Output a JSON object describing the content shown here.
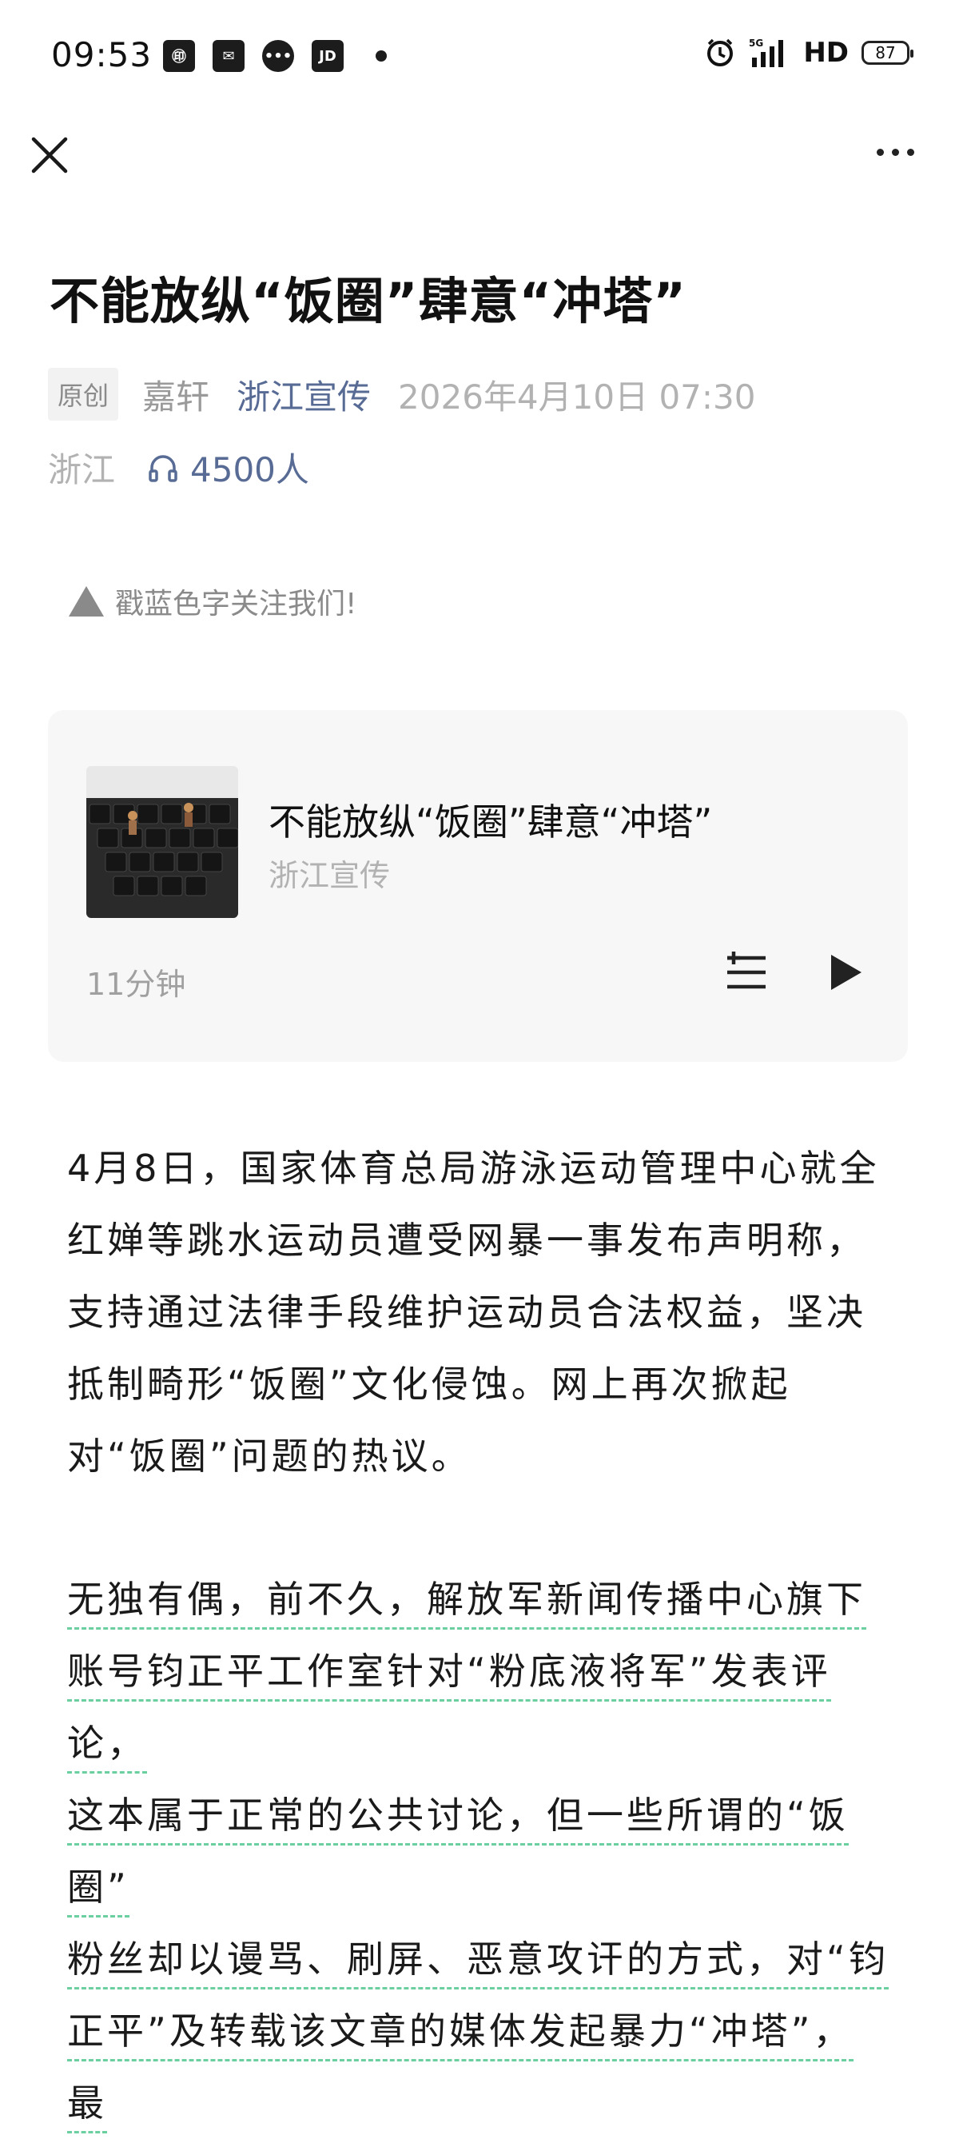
{
  "status_bar": {
    "time": "09:53",
    "left_icons": [
      {
        "name": "app-icon-1",
        "text": "㊞"
      },
      {
        "name": "app-icon-2",
        "text": "✉"
      },
      {
        "name": "message-icon",
        "text": "•••"
      },
      {
        "name": "jd-icon",
        "text": "JD"
      }
    ],
    "network": "5G",
    "hd": "HD",
    "battery": "87"
  },
  "article": {
    "title": "不能放纵“饭圈”肆意“冲塔”",
    "badge": "原创",
    "author": "嘉轩",
    "account": "浙江宣传",
    "date": "2026年4月10日 07:30",
    "location": "浙江",
    "listeners": "4500人",
    "follow_tip": "戳蓝色字关注我们!"
  },
  "audio_card": {
    "title": "不能放纵“饭圈”肆意“冲塔”",
    "source": "浙江宣传",
    "duration": "11分钟"
  },
  "body": {
    "paragraph1": "4月8日，国家体育总局游泳运动管理中心就全红婵等跳水运动员遭受网暴一事发布声明称，支持通过法律手段维护运动员合法权益，坚决抵制畸形“饭圈”文化侵蚀。网上再次掀起对“饭圈”问题的热议。",
    "paragraph2_lines": [
      "无独有偶，前不久，解放军新闻传播中心旗下",
      "账号钧正平工作室针对“粉底液将军”发表评论，",
      "这本属于正常的公共讨论，但一些所谓的“饭圈”",
      "粉丝却以谩骂、刷屏、恶意攻讦的方式，对“钧",
      "正平”及转载该文章的媒体发起暴力“冲塔”，最"
    ]
  }
}
